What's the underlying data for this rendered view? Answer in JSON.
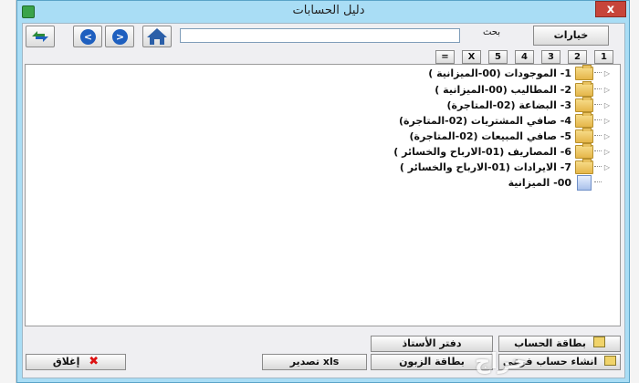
{
  "window": {
    "title": "دليل الحسابات",
    "close_glyph": "x"
  },
  "toolbar": {
    "search_label": "بحث",
    "search_value": "",
    "options_label": "خيارات",
    "levels": [
      "1",
      "2",
      "3",
      "4",
      "5",
      "X",
      "="
    ]
  },
  "tree": {
    "items": [
      {
        "label": "1- الموجودات  (00-الميزانية )"
      },
      {
        "label": "2- المطاليب  (00-الميزانية )"
      },
      {
        "label": "3- البضاعة (02-المتاجرة)"
      },
      {
        "label": "4- صافي المشتريات (02-المتاجرة)"
      },
      {
        "label": "5- صافي المبيعات (02-المتاجرة)"
      },
      {
        "label": "6- المصاريف  (01-الارباح والخسائر )"
      },
      {
        "label": "7- الايرادات  (01-الارباح والخسائر )"
      },
      {
        "label": "00- الميزانية"
      }
    ]
  },
  "buttons": {
    "account_card": "بطاقة الحساب",
    "ledger": "دفتر الأستاذ",
    "create_sub_account": "انشاء حساب فرعي",
    "customer_card": "بطاقة الزبون",
    "export_xls": "تصدير xls",
    "close": "إغلاق"
  },
  "colors": {
    "frame": "#a9ddf5",
    "nav_circle": "#1e5fbf",
    "folder": "#e5b64a"
  }
}
